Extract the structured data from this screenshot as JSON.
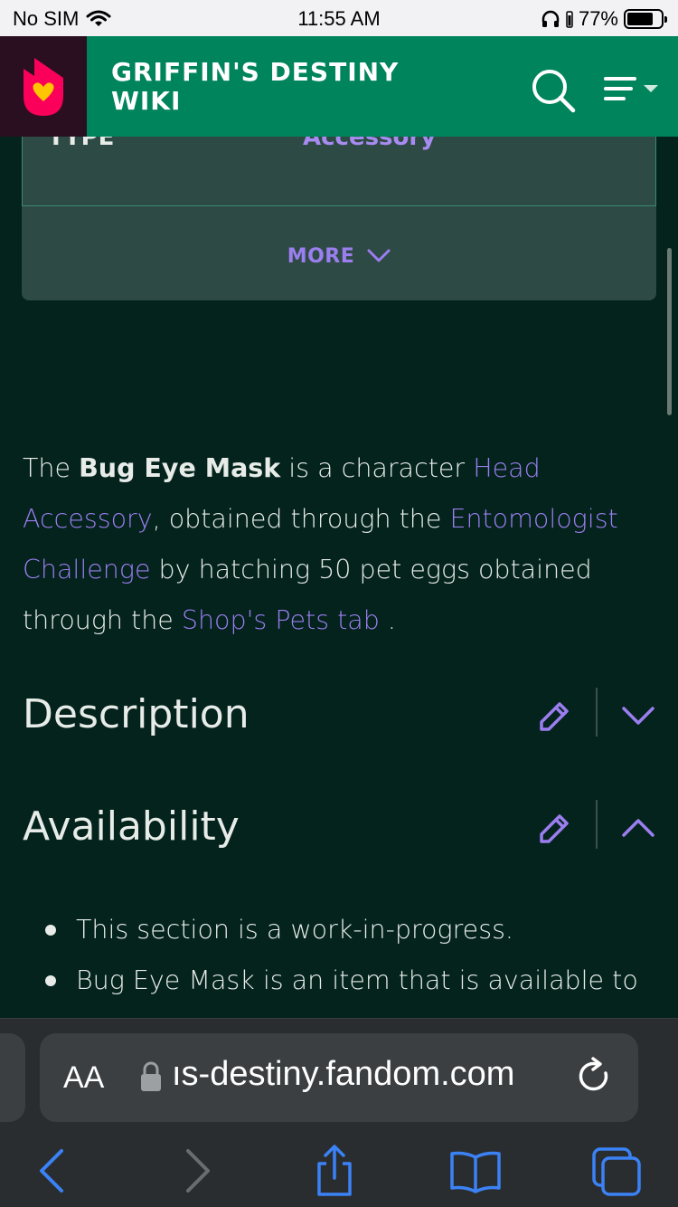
{
  "status_bar": {
    "carrier": "No SIM",
    "time": "11:55 AM",
    "battery": "77%",
    "battery_level": 0.77
  },
  "header": {
    "title": "GRIFFIN'S DESTINY WIKI",
    "icons": {
      "logo": "fandom-logo-icon",
      "search": "search-icon",
      "menu": "menu-icon"
    }
  },
  "infobox": {
    "row_label_partial": "TYPE",
    "row_value_partial": "Accessory",
    "more_label": "MORE"
  },
  "article": {
    "intro": {
      "t1": "The ",
      "bold_name": "Bug Eye Mask",
      "t2": " is a character ",
      "link1": "Head Accessory",
      "t3": ", obtained through the ",
      "link2": "Entomologist Challenge",
      "t4": " by hatching 50 pet eggs obtained through the ",
      "link3": "Shop's Pets tab",
      "t5": " ."
    },
    "sections": [
      {
        "title": "Description",
        "expanded": false
      },
      {
        "title": "Availability",
        "expanded": true
      }
    ],
    "availability_items": [
      "This section is a work-in-progress.",
      "Bug Eye Mask is an item that is available to"
    ]
  },
  "browser": {
    "text_size_label": "AA",
    "url": "griffins-destiny.fandom.com",
    "url_visible": "ıs-destiny.fandom.com"
  },
  "colors": {
    "background": "#03231c",
    "header": "#00845c",
    "link": "#9b7ef0",
    "infobox": "#2e4a44"
  }
}
